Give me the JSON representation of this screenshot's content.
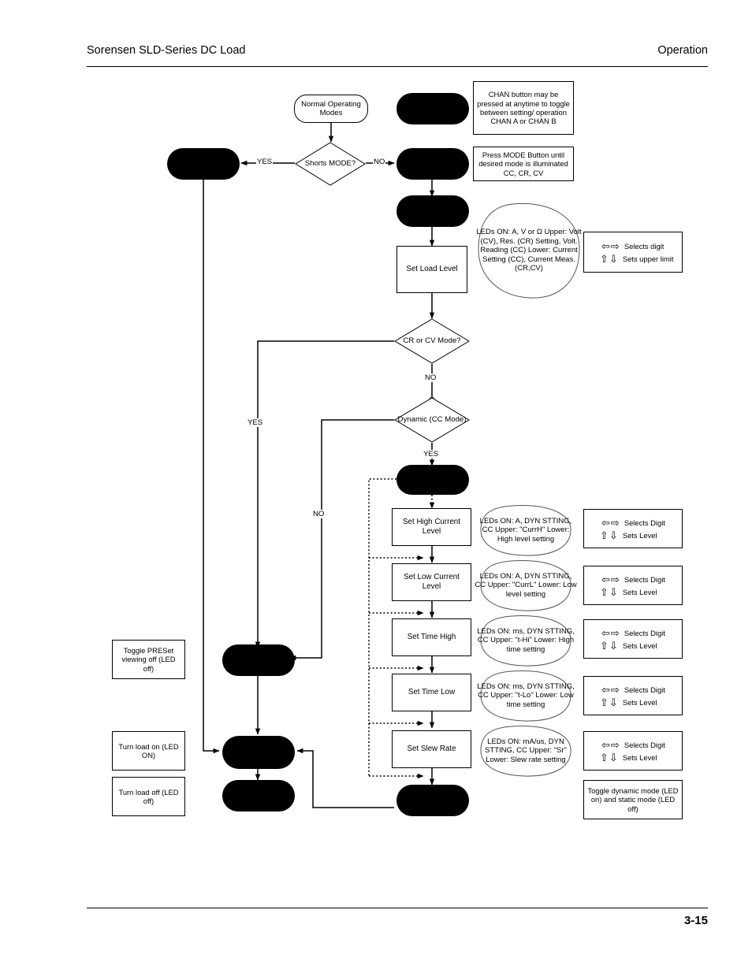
{
  "header": {
    "title": "Sorensen SLD-Series DC Load",
    "section": "Operation"
  },
  "footer": {
    "page_number": "3-15"
  },
  "flowchart": {
    "type": "flowchart",
    "terminators": [
      {
        "id": "start",
        "label": "Normal Operating\nModes"
      }
    ],
    "decisions": [
      {
        "id": "shorts_mode",
        "label": "Shorts MODE?"
      },
      {
        "id": "cr_or_cv",
        "label": "CR or CV\nMode?"
      },
      {
        "id": "dynamic_cc",
        "label": "Dynamic\n(CC Mode)"
      }
    ],
    "processes": [
      {
        "id": "set_load_level",
        "label": "Set Load Level"
      },
      {
        "id": "set_high_current",
        "label": "Set High Current\nLevel"
      },
      {
        "id": "set_low_current",
        "label": "Set Low Current\nLevel"
      },
      {
        "id": "set_time_high",
        "label": "Set Time High"
      },
      {
        "id": "set_time_low",
        "label": "Set Time Low"
      },
      {
        "id": "set_slew_rate",
        "label": "Set Slew Rate"
      }
    ],
    "redacted_nodes": [
      {
        "id": "redacted-shorts-yes"
      },
      {
        "id": "redacted-chan"
      },
      {
        "id": "redacted-mode"
      },
      {
        "id": "redacted-mode-2"
      },
      {
        "id": "redacted-dynamic"
      },
      {
        "id": "redacted-preset"
      },
      {
        "id": "redacted-load-on"
      },
      {
        "id": "redacted-load-off"
      },
      {
        "id": "redacted-dyn-exit"
      }
    ],
    "edge_labels": [
      {
        "id": "shorts-yes",
        "text": "YES"
      },
      {
        "id": "shorts-no",
        "text": "NO"
      },
      {
        "id": "crcv-yes",
        "text": "YES"
      },
      {
        "id": "crcv-no",
        "text": "NO"
      },
      {
        "id": "dyn-yes",
        "text": "YES"
      },
      {
        "id": "dyn-no",
        "text": "NO"
      }
    ],
    "notes": [
      {
        "id": "chan-note",
        "text": "CHAN button may be pressed at anytime to toggle between setting/ operation CHAN A or CHAN B"
      },
      {
        "id": "mode-note",
        "text": "Press MODE Button until desired mode is illuminated CC, CR, CV"
      },
      {
        "id": "preset-note",
        "text": "Toggle PRESet viewing off (LED off)"
      },
      {
        "id": "load-on-note",
        "text": "Turn load on (LED ON)"
      },
      {
        "id": "load-off-note",
        "text": "Turn load off (LED off)"
      },
      {
        "id": "dynamic-note",
        "text": "Toggle dynamic mode (LED on) and static mode (LED off)"
      }
    ],
    "led_annotations": [
      {
        "id": "led-load-level",
        "text": "LEDs ON: A, V or Ω Upper: Volt (CV), Res. (CR) Setting, Volt. Reading (CC) Lower: Current Setting (CC), Current Meas. (CR,CV)"
      },
      {
        "id": "led-high-current",
        "text": "LEDs ON: A, DYN STTING, CC Upper: \"CurrH\" Lower: High level setting"
      },
      {
        "id": "led-low-current",
        "text": "LEDs ON: A, DYN STTING, CC Upper: \"CurrL\" Lower: Low level setting"
      },
      {
        "id": "led-time-high",
        "text": "LEDs ON: ms, DYN STTING, CC Upper: \"t-Hi\" Lower: High time setting"
      },
      {
        "id": "led-time-low",
        "text": "LEDs ON: ms, DYN STTING, CC Upper: \"t-Lo\" Lower: Low time setting"
      },
      {
        "id": "led-slew-rate",
        "text": "LEDs ON: mA/us, DYN STTING, CC Upper: \"Sr\" Lower: Slew rate setting"
      }
    ],
    "key_boxes": [
      {
        "id": "key-load-level",
        "left_right_label": "Selects digit",
        "up_down_label": "Sets upper limit"
      },
      {
        "id": "key-high-current",
        "left_right_label": "Selects Digit",
        "up_down_label": "Sets Level"
      },
      {
        "id": "key-low-current",
        "left_right_label": "Selects Digit",
        "up_down_label": "Sets Level"
      },
      {
        "id": "key-time-high",
        "left_right_label": "Selects Digit",
        "up_down_label": "Sets Level"
      },
      {
        "id": "key-time-low",
        "left_right_label": "Selects Digit",
        "up_down_label": "Sets Level"
      },
      {
        "id": "key-slew-rate",
        "left_right_label": "Selects Digit",
        "up_down_label": "Sets Level"
      }
    ],
    "glyphs": {
      "arrow_left": "⇦",
      "arrow_right": "⇨",
      "arrow_up": "⇧",
      "arrow_down": "⇩"
    },
    "colors": {
      "stroke": "#000000",
      "redacted_fill": "#000000",
      "node_fill": "#ffffff"
    }
  }
}
